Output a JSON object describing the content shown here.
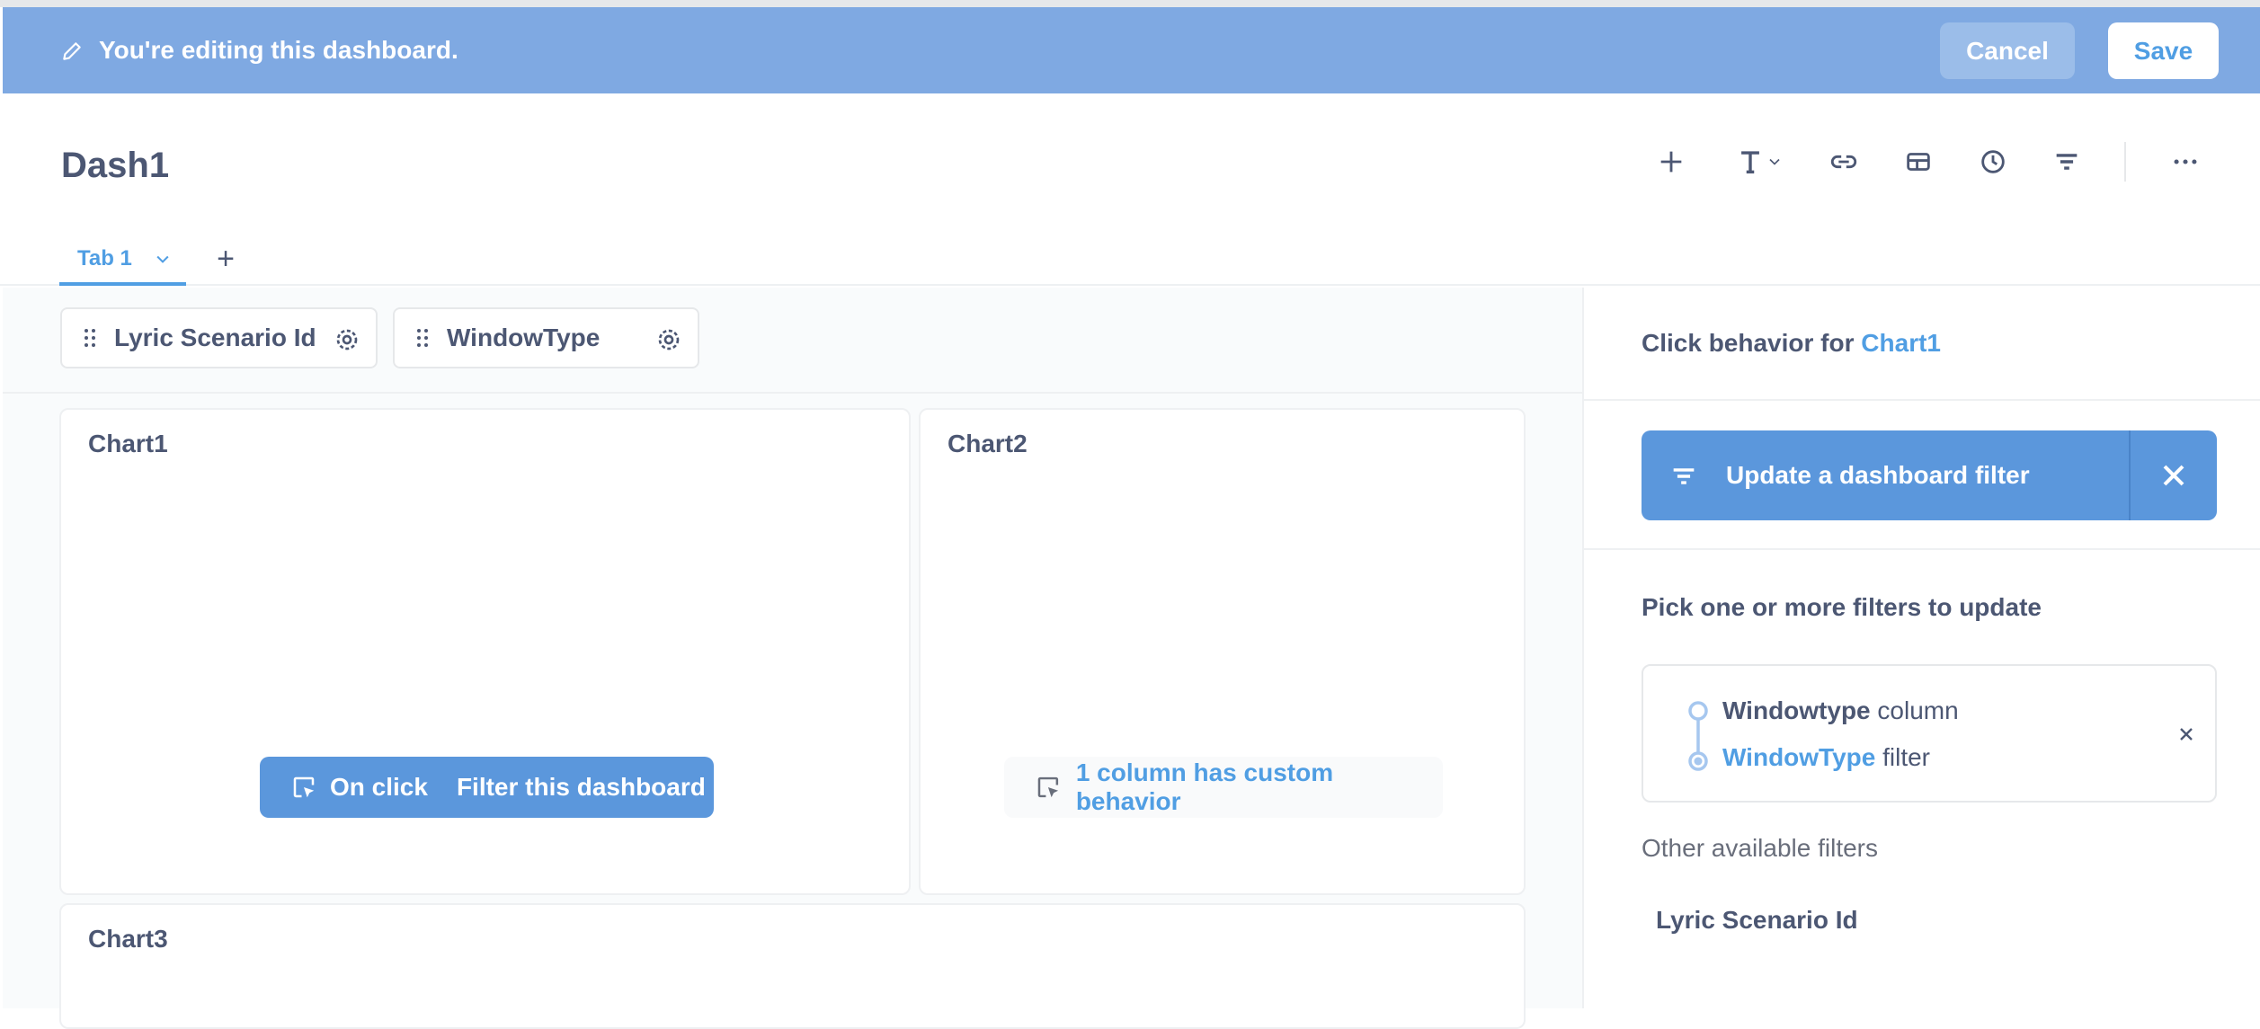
{
  "edit_bar": {
    "message": "You're editing this dashboard.",
    "cancel_label": "Cancel",
    "save_label": "Save"
  },
  "dashboard": {
    "title": "Dash1"
  },
  "toolbar": {
    "icons": [
      "add-icon",
      "text-icon",
      "link-icon",
      "section-icon",
      "clock-icon",
      "filter-icon",
      "more-icon"
    ]
  },
  "tabs": [
    {
      "label": "Tab 1",
      "active": true
    }
  ],
  "filters": [
    {
      "label": "Lyric Scenario Id"
    },
    {
      "label": "WindowType"
    }
  ],
  "cards": {
    "chart1": {
      "title": "Chart1",
      "onclick_label": "On click",
      "onclick_action": "Filter this dashboard"
    },
    "chart2": {
      "title": "Chart2",
      "custom_behavior": "1 column has custom behavior"
    },
    "chart3": {
      "title": "Chart3"
    }
  },
  "sidebar": {
    "heading_prefix": "Click behavior for",
    "heading_target": "Chart1",
    "behavior_label": "Update a dashboard filter",
    "pick_title": "Pick one or more filters to update",
    "mapping": {
      "source_name": "Windowtype",
      "source_suffix": "column",
      "target_name": "WindowType",
      "target_suffix": "filter"
    },
    "other_title": "Other available filters",
    "other_filters": [
      "Lyric Scenario Id"
    ]
  },
  "colors": {
    "edit_bar": "#7fa9e2",
    "brand": "#509ee3",
    "pill": "#5b97dc",
    "text": "#4c5773"
  }
}
